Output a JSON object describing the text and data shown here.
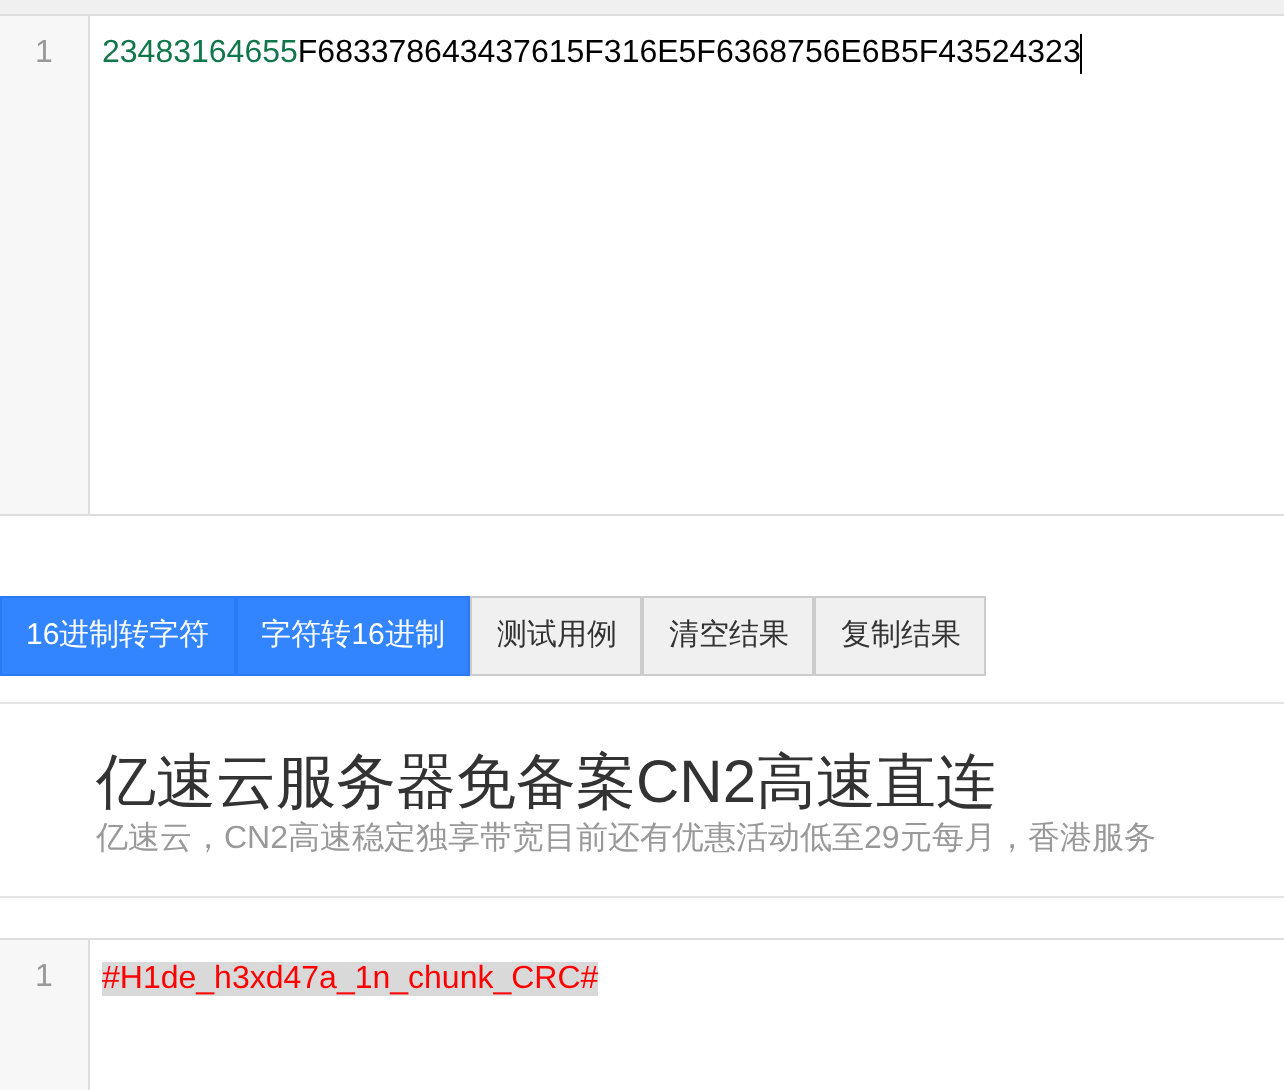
{
  "input_editor": {
    "line_number": "1",
    "tokens": [
      {
        "kind": "number",
        "text": "23483164655"
      },
      {
        "kind": "plain",
        "text": "F683378643437615F316E5F6368756E6B5F43524323"
      }
    ]
  },
  "buttons": [
    {
      "label": "16进制转字符",
      "selected": true
    },
    {
      "label": "字符转16进制",
      "selected": true
    },
    {
      "label": "测试用例",
      "selected": false
    },
    {
      "label": "清空结果",
      "selected": false
    },
    {
      "label": "复制结果",
      "selected": false
    }
  ],
  "ad": {
    "title": "亿速云服务器免备案CN2高速直连",
    "description": "亿速云，CN2高速稳定独享带宽目前还有优惠活动低至29元每月，香港服务"
  },
  "output_editor": {
    "line_number": "1",
    "text": "#H1de_h3xd47a_1n_chunk_CRC#"
  }
}
